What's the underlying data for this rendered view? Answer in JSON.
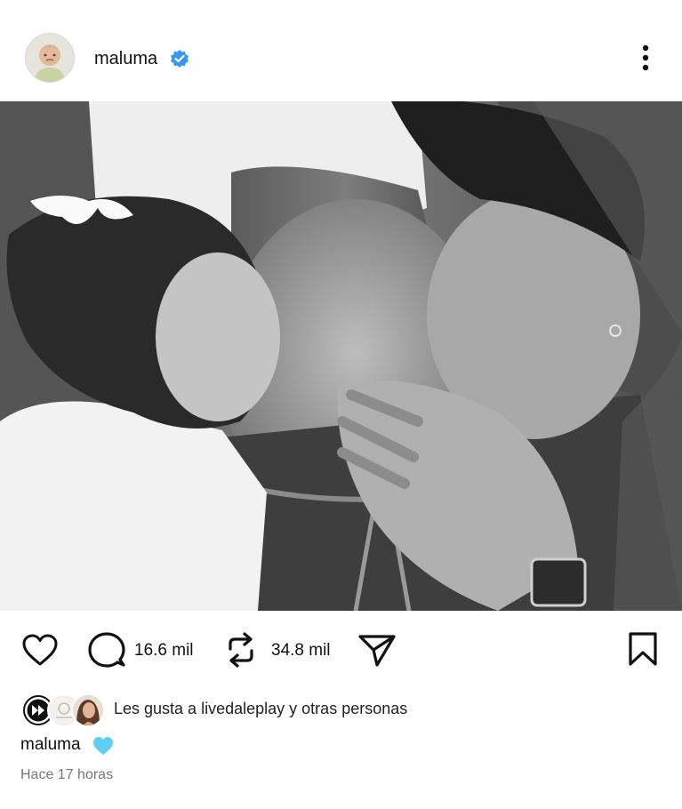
{
  "post": {
    "username": "maluma",
    "more_icon": "more-vertical-icon",
    "verified_icon": "verified-badge-icon",
    "photo_alt": ""
  },
  "actions": {
    "like_icon": "heart-icon",
    "comment_icon": "comment-icon",
    "comment_count": "16.6 mil",
    "repost_icon": "repost-icon",
    "repost_count": "34.8 mil",
    "share_icon": "send-icon",
    "save_icon": "bookmark-icon"
  },
  "likes": {
    "prefix": "Les gusta a",
    "user": "livedaleplay",
    "suffix": "y otras personas"
  },
  "caption": {
    "username": "maluma",
    "emoji_icon": "light-blue-heart-icon"
  },
  "timestamp": "Hace 17 horas",
  "colors": {
    "verified": "#3897f0",
    "text": "#111111",
    "muted": "#777777",
    "heart_blue": "#5fd0f5"
  }
}
